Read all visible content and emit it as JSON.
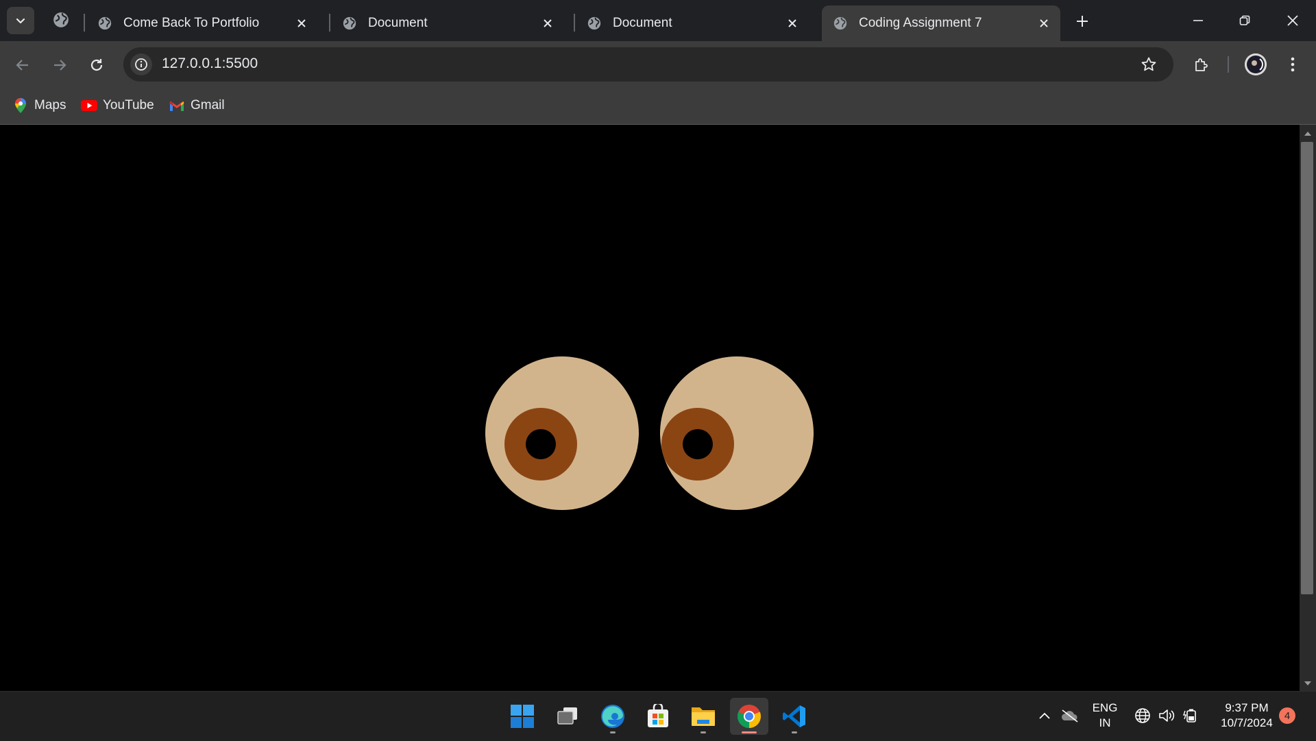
{
  "tabs": [
    {
      "title": "Come Back To Portfolio",
      "favicon": "globe-icon"
    },
    {
      "title": "Document",
      "favicon": "globe-icon"
    },
    {
      "title": "Document",
      "favicon": "globe-icon"
    },
    {
      "title": "Coding Assignment 7",
      "favicon": "globe-icon",
      "active": true
    }
  ],
  "address_bar": {
    "url": "127.0.0.1:5500"
  },
  "bookmarks": [
    {
      "label": "Maps",
      "icon": "maps-pin-icon"
    },
    {
      "label": "YouTube",
      "icon": "youtube-icon"
    },
    {
      "label": "Gmail",
      "icon": "gmail-icon"
    }
  ],
  "page": {
    "background": "#000000",
    "eye_color": "#d2b48c",
    "iris_color": "#8b4513",
    "pupil_color": "#000000"
  },
  "taskbar": {
    "apps": [
      "windows-start-icon",
      "task-view-icon",
      "edge-icon",
      "store-icon",
      "file-explorer-icon",
      "chrome-icon",
      "vscode-icon"
    ],
    "language": {
      "line1": "ENG",
      "line2": "IN"
    },
    "time": "9:37 PM",
    "date": "10/7/2024",
    "notification_count": "4"
  }
}
